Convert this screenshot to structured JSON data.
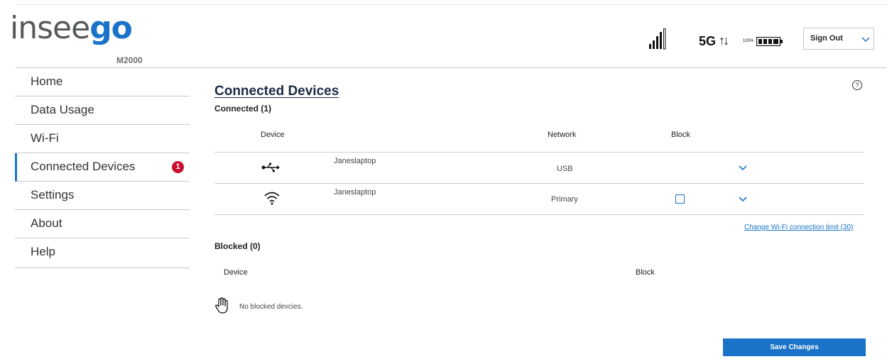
{
  "header": {
    "logo_prefix": "insee",
    "logo_suffix": "go",
    "model": "M2000",
    "network_type": "5G",
    "transfer_arrows": "↑↓",
    "battery_percent": "100%",
    "signal_icon": "signal-bars-icon",
    "battery_icon": "battery-full-icon",
    "signout_label": "Sign Out"
  },
  "sidebar": {
    "items": [
      {
        "label": "Home"
      },
      {
        "label": "Data Usage"
      },
      {
        "label": "Wi-Fi"
      },
      {
        "label": "Connected Devices",
        "badge": "1",
        "active": true
      },
      {
        "label": "Settings"
      },
      {
        "label": "About"
      },
      {
        "label": "Help"
      }
    ]
  },
  "main": {
    "title": "Connected Devices",
    "help_symbol": "?",
    "connected": {
      "label": "Connected (1)",
      "columns": {
        "device": "Device",
        "network": "Network",
        "block": "Block"
      },
      "rows": [
        {
          "icon": "usb-icon",
          "name": "Janeslaptop",
          "network": "USB",
          "blockable": false
        },
        {
          "icon": "wifi-icon",
          "name": "Janeslaptop",
          "network": "Primary",
          "blockable": true,
          "blocked": false
        }
      ]
    },
    "wifi_limit_link": "Change Wi-Fi connection limit (30)",
    "blocked": {
      "label": "Blocked (0)",
      "columns": {
        "device": "Device",
        "block": "Block"
      },
      "empty_text": "No blocked devcies."
    },
    "save_label": "Save Changes"
  },
  "colors": {
    "accent": "#1a73c8",
    "badge": "#c8102e",
    "logo_gray": "#58595b"
  }
}
